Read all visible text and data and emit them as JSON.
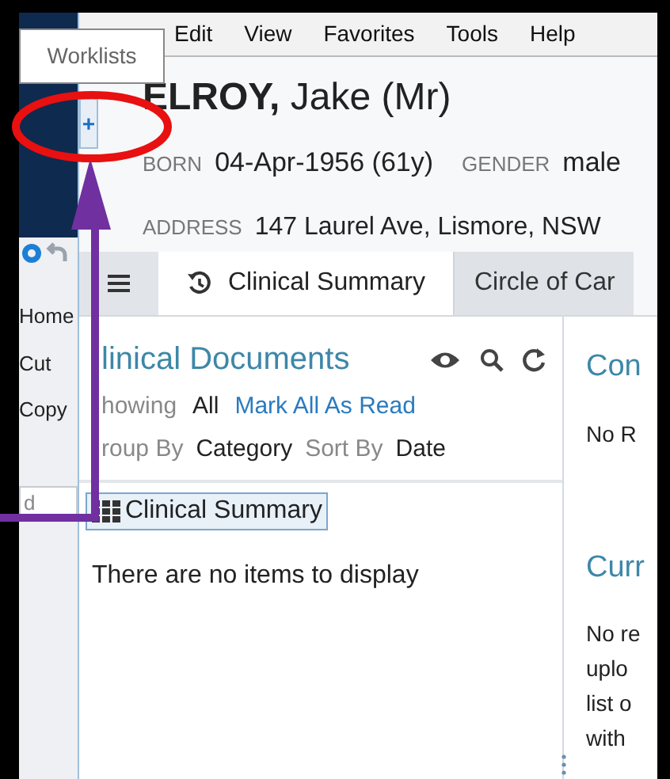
{
  "tooltip": {
    "text": "Worklists"
  },
  "menu": [
    "Edit",
    "View",
    "Favorites",
    "Tools",
    "Help"
  ],
  "expand_button": "+",
  "sidebar": {
    "items": [
      {
        "label": "Home"
      },
      {
        "label": "Cut"
      },
      {
        "label": "Copy"
      }
    ],
    "field_value": "d"
  },
  "patient": {
    "surname": "ELROY,",
    "given": "Jake (Mr)",
    "born_label": "BORN",
    "born": "04-Apr-1956 (61y)",
    "gender_label": "GENDER",
    "gender": "male",
    "address_label": "ADDRESS",
    "address": "147 Laurel Ave, Lismore, NSW"
  },
  "tabs": [
    {
      "label": "Clinical Summary",
      "selected": true
    },
    {
      "label": "Circle of Car",
      "selected": false
    }
  ],
  "documents": {
    "title": "linical Documents",
    "showing_label": "howing",
    "showing": "All",
    "mark_link": "Mark All As Read",
    "group_label": "roup By",
    "group": "Category",
    "sort_label": "Sort By",
    "sort": "Date",
    "chip": "Clinical Summary",
    "empty": "There are no items to display"
  },
  "right_panel": {
    "sections": [
      {
        "heading": "Con",
        "lines": [
          "No R"
        ]
      },
      {
        "heading": "Curr",
        "lines": [
          "No re",
          "uplo",
          "list o",
          "with"
        ]
      }
    ]
  }
}
